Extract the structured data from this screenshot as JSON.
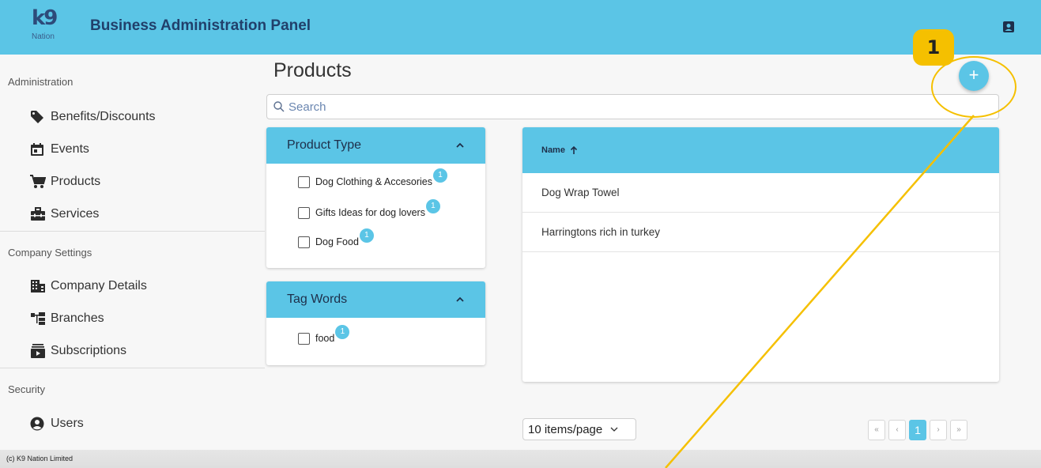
{
  "header": {
    "logo_mark": "k9",
    "logo_sub": "Nation",
    "title": "Business Administration Panel"
  },
  "sidebar": {
    "sections": [
      {
        "title": "Administration",
        "items": [
          {
            "label": "Benefits/Discounts",
            "icon": "tag-icon"
          },
          {
            "label": "Events",
            "icon": "calendar-icon"
          },
          {
            "label": "Products",
            "icon": "cart-icon"
          },
          {
            "label": "Services",
            "icon": "toolbox-icon"
          }
        ]
      },
      {
        "title": "Company Settings",
        "items": [
          {
            "label": "Company Details",
            "icon": "building-icon"
          },
          {
            "label": "Branches",
            "icon": "sitemap-icon"
          },
          {
            "label": "Subscriptions",
            "icon": "subscriptions-icon"
          }
        ]
      },
      {
        "title": "Security",
        "items": [
          {
            "label": "Users",
            "icon": "user-circle-icon"
          }
        ]
      }
    ]
  },
  "main": {
    "title": "Products",
    "search_placeholder": "Search",
    "add_label": "+",
    "filters": [
      {
        "title": "Product Type",
        "options": [
          {
            "label": "Dog Clothing & Accesories",
            "count": "1"
          },
          {
            "label": "Gifts Ideas for dog lovers",
            "count": "1"
          },
          {
            "label": "Dog Food",
            "count": "1"
          }
        ]
      },
      {
        "title": "Tag Words",
        "options": [
          {
            "label": "food",
            "count": "1"
          }
        ]
      }
    ],
    "table": {
      "column": "Name",
      "rows": [
        "Dog Wrap Towel",
        "Harringtons rich in turkey"
      ]
    },
    "pagination": {
      "per_page": "10 items/page",
      "first": "«",
      "prev": "‹",
      "current": "1",
      "next": "›",
      "last": "»"
    }
  },
  "footer": {
    "text": "(c) K9 Nation Limited"
  },
  "annotation": {
    "number": "1"
  },
  "colors": {
    "accent": "#5bc5e6",
    "header_text": "#21406b",
    "annotation": "#f5c000"
  }
}
